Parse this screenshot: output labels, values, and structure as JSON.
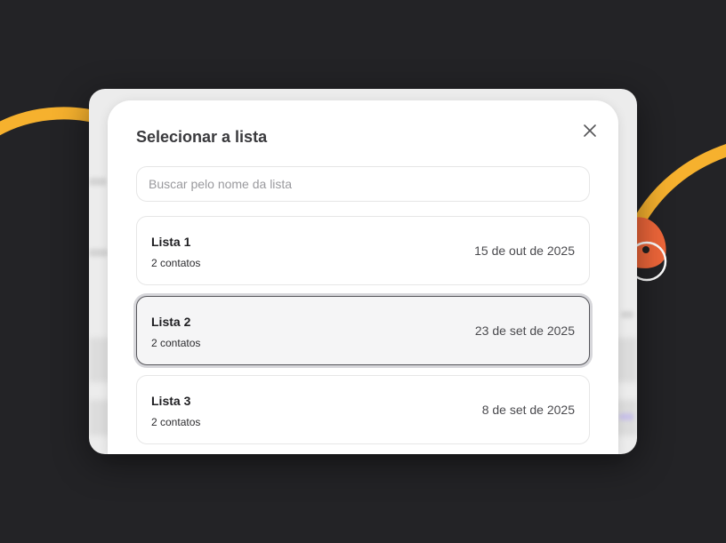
{
  "modal": {
    "title": "Selecionar a lista",
    "search": {
      "placeholder": "Buscar pelo nome da lista",
      "value": ""
    },
    "lists": [
      {
        "name": "Lista 1",
        "contacts": "2 contatos",
        "date": "15 de out de 2025",
        "selected": false
      },
      {
        "name": "Lista 2",
        "contacts": "2 contatos",
        "date": "23 de set de 2025",
        "selected": true
      },
      {
        "name": "Lista 3",
        "contacts": "2 contatos",
        "date": "8 de set de 2025",
        "selected": false
      }
    ]
  },
  "colors": {
    "background": "#232326",
    "accent_curve": "#f6b12e",
    "accent_orange": "#f0673a",
    "selected_border": "#55555a"
  },
  "icons": {
    "close": "close-icon"
  }
}
